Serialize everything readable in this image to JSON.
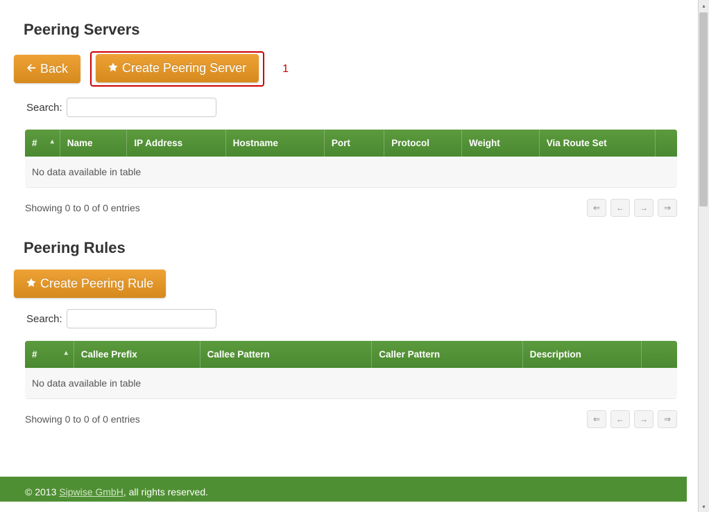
{
  "callout_number": "1",
  "servers": {
    "title": "Peering Servers",
    "back_label": "Back",
    "create_label": "Create Peering Server",
    "search_label": "Search:",
    "columns": [
      "#",
      "Name",
      "IP Address",
      "Hostname",
      "Port",
      "Protocol",
      "Weight",
      "Via Route Set",
      ""
    ],
    "empty_text": "No data available in table",
    "info_text": "Showing 0 to 0 of 0 entries"
  },
  "rules": {
    "title": "Peering Rules",
    "create_label": "Create Peering Rule",
    "search_label": "Search:",
    "columns": [
      "#",
      "Callee Prefix",
      "Callee Pattern",
      "Caller Pattern",
      "Description",
      ""
    ],
    "empty_text": "No data available in table",
    "info_text": "Showing 0 to 0 of 0 entries"
  },
  "footer": {
    "copyright_prefix": "© 2013 ",
    "company": "Sipwise GmbH",
    "copyright_suffix": ", all rights reserved."
  }
}
